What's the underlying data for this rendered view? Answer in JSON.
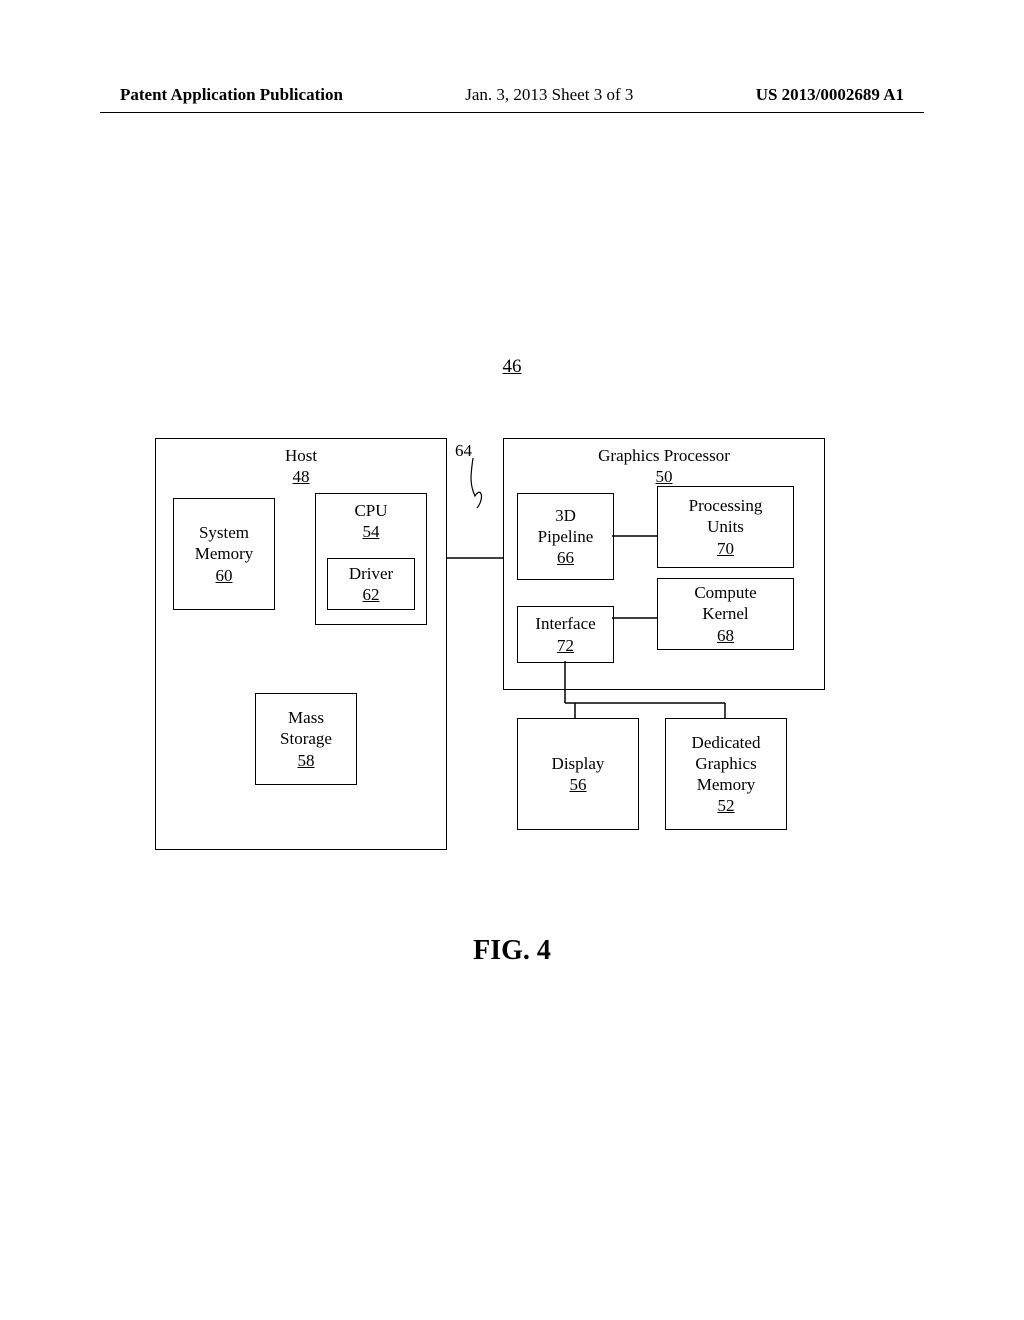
{
  "header": {
    "left": "Patent Application Publication",
    "middle": "Jan. 3, 2013   Sheet 3 of 3",
    "right": "US 2013/0002689 A1"
  },
  "figure_ref": "46",
  "caption": "FIG. 4",
  "bus_ref": "64",
  "host": {
    "title": "Host",
    "ref": "48",
    "sysmem": {
      "title": "System\nMemory",
      "ref": "60"
    },
    "cpu": {
      "title": "CPU",
      "ref": "54"
    },
    "driver": {
      "title": "Driver",
      "ref": "62"
    },
    "mass": {
      "title": "Mass\nStorage",
      "ref": "58"
    }
  },
  "gpu": {
    "title": "Graphics Processor",
    "ref": "50",
    "pipeline": {
      "title": "3D\nPipeline",
      "ref": "66"
    },
    "units": {
      "title": "Processing\nUnits",
      "ref": "70"
    },
    "iface": {
      "title": "Interface",
      "ref": "72"
    },
    "kernel": {
      "title": "Compute\nKernel",
      "ref": "68"
    }
  },
  "display": {
    "title": "Display",
    "ref": "56"
  },
  "dmem": {
    "title": "Dedicated\nGraphics\nMemory",
    "ref": "52"
  }
}
